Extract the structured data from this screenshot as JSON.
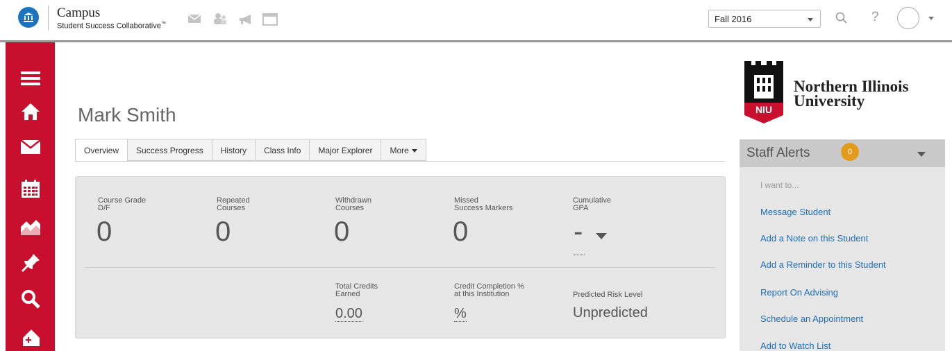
{
  "header": {
    "brand_title": "Campus",
    "brand_subtitle": "Student Success Collaborative",
    "brand_trademark": "™",
    "term": "Fall 2016",
    "icons": [
      "mail-icon",
      "students-icon",
      "megaphone-icon",
      "window-icon",
      "search-icon",
      "help-icon"
    ],
    "help_glyph": "?"
  },
  "sidebar": {
    "items": [
      "menu-icon",
      "home-icon",
      "mail-icon",
      "calendar-icon",
      "chart-icon",
      "pin-icon",
      "search-icon",
      "add-tag-icon"
    ]
  },
  "student": {
    "name": "Mark Smith"
  },
  "tabs": [
    {
      "label": "Overview",
      "active": true
    },
    {
      "label": "Success Progress"
    },
    {
      "label": "History"
    },
    {
      "label": "Class Info"
    },
    {
      "label": "Major Explorer"
    },
    {
      "label": "More"
    }
  ],
  "metrics": {
    "course_grade": {
      "label1": "Course Grade",
      "label2": "D/F",
      "value": "0"
    },
    "repeated": {
      "label1": "Repeated",
      "label2": "Courses",
      "value": "0"
    },
    "withdrawn": {
      "label1": "Withdrawn",
      "label2": "Courses",
      "value": "0"
    },
    "missed": {
      "label1": "Missed",
      "label2": "Success Markers",
      "value": "0"
    },
    "gpa": {
      "label1": "Cumulative",
      "label2": "GPA",
      "value": "-"
    },
    "credits": {
      "label1": "Total Credits",
      "label2": "Earned",
      "value": "0.00"
    },
    "completion": {
      "label1": "Credit Completion %",
      "label2": "at this Institution",
      "value": "%"
    },
    "risk": {
      "label": "Predicted Risk Level",
      "value": "Unpredicted"
    }
  },
  "university": {
    "name_line1": "Northern Illinois",
    "name_line2": "University",
    "shield_text": "NIU",
    "colors": {
      "red": "#c8102e",
      "black": "#111111"
    }
  },
  "staff_alerts": {
    "title": "Staff Alerts",
    "count": "0",
    "prompt": "I want to...",
    "actions": [
      "Message Student",
      "Add a Note on this Student",
      "Add a Reminder to this Student",
      "Report On Advising",
      "Schedule an Appointment",
      "Add to Watch List"
    ]
  },
  "colors": {
    "brand_blue": "#1e73be",
    "sidebar_red": "#c8102e",
    "link_blue": "#1f6fb8",
    "badge_orange": "#e39b1c"
  }
}
